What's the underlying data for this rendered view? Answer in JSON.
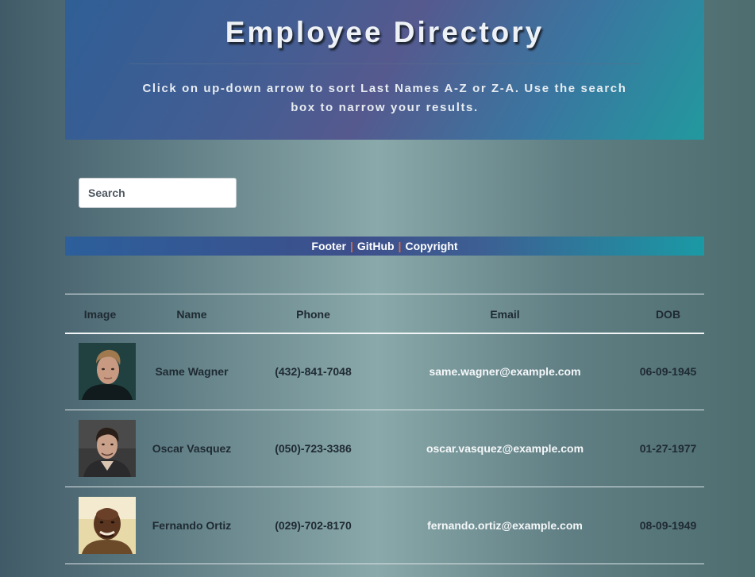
{
  "header": {
    "title": "Employee Directory",
    "subtitle": "Click on up-down arrow to sort Last Names A-Z or Z-A. Use the search box to narrow your results."
  },
  "search": {
    "placeholder": "Search",
    "value": ""
  },
  "footer": {
    "links": [
      "Footer",
      "GitHub",
      "Copyright"
    ],
    "separator": "|",
    "separator_color": "#e0683c"
  },
  "table": {
    "headers": [
      "Image",
      "Name",
      "Phone",
      "Email",
      "DOB"
    ],
    "rows": [
      {
        "name": "Same Wagner",
        "phone": "(432)-841-7048",
        "email": "same.wagner@example.com",
        "dob": "06-09-1945",
        "photo_icon": "portrait-photo"
      },
      {
        "name": "Oscar Vasquez",
        "phone": "(050)-723-3386",
        "email": "oscar.vasquez@example.com",
        "dob": "01-27-1977",
        "photo_icon": "portrait-photo"
      },
      {
        "name": "Fernando Ortiz",
        "phone": "(029)-702-8170",
        "email": "fernando.ortiz@example.com",
        "dob": "08-09-1949",
        "photo_icon": "portrait-photo"
      }
    ]
  },
  "colors": {
    "header_gradient_start": "#2f5f96",
    "header_gradient_end": "#22999e",
    "email_text": "#f6f8fa",
    "body_text": "#1f2a33"
  }
}
